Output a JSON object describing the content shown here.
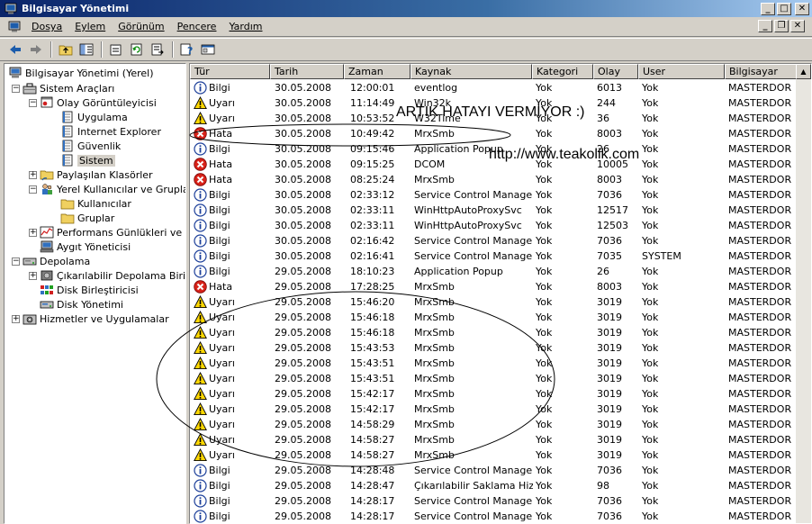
{
  "window": {
    "title": "Bilgisayar Yönetimi"
  },
  "menubar": {
    "items": [
      {
        "label": "Dosya"
      },
      {
        "label": "Eylem"
      },
      {
        "label": "Görünüm"
      },
      {
        "label": "Pencere"
      },
      {
        "label": "Yardım"
      }
    ]
  },
  "toolbar": {
    "buttons": [
      "back-icon",
      "forward-icon",
      "up-folder-icon",
      "show-tree-icon",
      "properties-icon",
      "refresh-icon",
      "export-icon",
      "help-icon",
      "console-icon"
    ]
  },
  "tree": {
    "items": [
      {
        "label": "Bilgisayar Yönetimi (Yerel)"
      },
      {
        "label": "Sistem Araçları"
      },
      {
        "label": "Olay Görüntüleyicisi"
      },
      {
        "label": "Uygulama"
      },
      {
        "label": "Internet Explorer"
      },
      {
        "label": "Güvenlik"
      },
      {
        "label": "Sistem"
      },
      {
        "label": "Paylaşılan Klasörler"
      },
      {
        "label": "Yerel Kullanıcılar ve Gruplar"
      },
      {
        "label": "Kullanıcılar"
      },
      {
        "label": "Gruplar"
      },
      {
        "label": "Performans Günlükleri ve Uy"
      },
      {
        "label": "Aygıt Yöneticisi"
      },
      {
        "label": "Depolama"
      },
      {
        "label": "Çıkarılabilir Depolama Birimi"
      },
      {
        "label": "Disk Birleştiricisi"
      },
      {
        "label": "Disk Yönetimi"
      },
      {
        "label": "Hizmetler ve Uygulamalar"
      }
    ]
  },
  "list": {
    "columns": [
      "Tür",
      "Tarih",
      "Zaman",
      "Kaynak",
      "Kategori",
      "Olay",
      "User",
      "Bilgisayar"
    ],
    "rows": [
      {
        "type": "Bilgi",
        "date": "30.05.2008",
        "time": "12:00:01",
        "source": "eventlog",
        "category": "Yok",
        "event": "6013",
        "user": "Yok",
        "computer": "MASTERDOR"
      },
      {
        "type": "Uyarı",
        "date": "30.05.2008",
        "time": "11:14:49",
        "source": "Win32k",
        "category": "Yok",
        "event": "244",
        "user": "Yok",
        "computer": "MASTERDOR"
      },
      {
        "type": "Uyarı",
        "date": "30.05.2008",
        "time": "10:53:52",
        "source": "W32Time",
        "category": "Yok",
        "event": "36",
        "user": "Yok",
        "computer": "MASTERDOR"
      },
      {
        "type": "Hata",
        "date": "30.05.2008",
        "time": "10:49:42",
        "source": "MrxSmb",
        "category": "Yok",
        "event": "8003",
        "user": "Yok",
        "computer": "MASTERDOR"
      },
      {
        "type": "Bilgi",
        "date": "30.05.2008",
        "time": "09:15:46",
        "source": "Application Popup",
        "category": "Yok",
        "event": "26",
        "user": "Yok",
        "computer": "MASTERDOR"
      },
      {
        "type": "Hata",
        "date": "30.05.2008",
        "time": "09:15:25",
        "source": "DCOM",
        "category": "Yok",
        "event": "10005",
        "user": "Yok",
        "computer": "MASTERDOR"
      },
      {
        "type": "Hata",
        "date": "30.05.2008",
        "time": "08:25:24",
        "source": "MrxSmb",
        "category": "Yok",
        "event": "8003",
        "user": "Yok",
        "computer": "MASTERDOR"
      },
      {
        "type": "Bilgi",
        "date": "30.05.2008",
        "time": "02:33:12",
        "source": "Service Control Manager",
        "category": "Yok",
        "event": "7036",
        "user": "Yok",
        "computer": "MASTERDOR"
      },
      {
        "type": "Bilgi",
        "date": "30.05.2008",
        "time": "02:33:11",
        "source": "WinHttpAutoProxySvc",
        "category": "Yok",
        "event": "12517",
        "user": "Yok",
        "computer": "MASTERDOR"
      },
      {
        "type": "Bilgi",
        "date": "30.05.2008",
        "time": "02:33:11",
        "source": "WinHttpAutoProxySvc",
        "category": "Yok",
        "event": "12503",
        "user": "Yok",
        "computer": "MASTERDOR"
      },
      {
        "type": "Bilgi",
        "date": "30.05.2008",
        "time": "02:16:42",
        "source": "Service Control Manager",
        "category": "Yok",
        "event": "7036",
        "user": "Yok",
        "computer": "MASTERDOR"
      },
      {
        "type": "Bilgi",
        "date": "30.05.2008",
        "time": "02:16:41",
        "source": "Service Control Manager",
        "category": "Yok",
        "event": "7035",
        "user": "SYSTEM",
        "computer": "MASTERDOR"
      },
      {
        "type": "Bilgi",
        "date": "29.05.2008",
        "time": "18:10:23",
        "source": "Application Popup",
        "category": "Yok",
        "event": "26",
        "user": "Yok",
        "computer": "MASTERDOR"
      },
      {
        "type": "Hata",
        "date": "29.05.2008",
        "time": "17:28:25",
        "source": "MrxSmb",
        "category": "Yok",
        "event": "8003",
        "user": "Yok",
        "computer": "MASTERDOR"
      },
      {
        "type": "Uyarı",
        "date": "29.05.2008",
        "time": "15:46:20",
        "source": "MrxSmb",
        "category": "Yok",
        "event": "3019",
        "user": "Yok",
        "computer": "MASTERDOR"
      },
      {
        "type": "Uyarı",
        "date": "29.05.2008",
        "time": "15:46:18",
        "source": "MrxSmb",
        "category": "Yok",
        "event": "3019",
        "user": "Yok",
        "computer": "MASTERDOR"
      },
      {
        "type": "Uyarı",
        "date": "29.05.2008",
        "time": "15:46:18",
        "source": "MrxSmb",
        "category": "Yok",
        "event": "3019",
        "user": "Yok",
        "computer": "MASTERDOR"
      },
      {
        "type": "Uyarı",
        "date": "29.05.2008",
        "time": "15:43:53",
        "source": "MrxSmb",
        "category": "Yok",
        "event": "3019",
        "user": "Yok",
        "computer": "MASTERDOR"
      },
      {
        "type": "Uyarı",
        "date": "29.05.2008",
        "time": "15:43:51",
        "source": "MrxSmb",
        "category": "Yok",
        "event": "3019",
        "user": "Yok",
        "computer": "MASTERDOR"
      },
      {
        "type": "Uyarı",
        "date": "29.05.2008",
        "time": "15:43:51",
        "source": "MrxSmb",
        "category": "Yok",
        "event": "3019",
        "user": "Yok",
        "computer": "MASTERDOR"
      },
      {
        "type": "Uyarı",
        "date": "29.05.2008",
        "time": "15:42:17",
        "source": "MrxSmb",
        "category": "Yok",
        "event": "3019",
        "user": "Yok",
        "computer": "MASTERDOR"
      },
      {
        "type": "Uyarı",
        "date": "29.05.2008",
        "time": "15:42:17",
        "source": "MrxSmb",
        "category": "Yok",
        "event": "3019",
        "user": "Yok",
        "computer": "MASTERDOR"
      },
      {
        "type": "Uyarı",
        "date": "29.05.2008",
        "time": "14:58:29",
        "source": "MrxSmb",
        "category": "Yok",
        "event": "3019",
        "user": "Yok",
        "computer": "MASTERDOR"
      },
      {
        "type": "Uyarı",
        "date": "29.05.2008",
        "time": "14:58:27",
        "source": "MrxSmb",
        "category": "Yok",
        "event": "3019",
        "user": "Yok",
        "computer": "MASTERDOR"
      },
      {
        "type": "Uyarı",
        "date": "29.05.2008",
        "time": "14:58:27",
        "source": "MrxSmb",
        "category": "Yok",
        "event": "3019",
        "user": "Yok",
        "computer": "MASTERDOR"
      },
      {
        "type": "Bilgi",
        "date": "29.05.2008",
        "time": "14:28:48",
        "source": "Service Control Manager",
        "category": "Yok",
        "event": "7036",
        "user": "Yok",
        "computer": "MASTERDOR"
      },
      {
        "type": "Bilgi",
        "date": "29.05.2008",
        "time": "14:28:47",
        "source": "Çıkarılabilir Saklama Hiz...",
        "category": "Yok",
        "event": "98",
        "user": "Yok",
        "computer": "MASTERDOR"
      },
      {
        "type": "Bilgi",
        "date": "29.05.2008",
        "time": "14:28:17",
        "source": "Service Control Manager",
        "category": "Yok",
        "event": "7036",
        "user": "Yok",
        "computer": "MASTERDOR"
      },
      {
        "type": "Bilgi",
        "date": "29.05.2008",
        "time": "14:28:17",
        "source": "Service Control Manager",
        "category": "Yok",
        "event": "7036",
        "user": "Yok",
        "computer": "MASTERDOR"
      }
    ]
  },
  "annotations": {
    "headline": "ARTIK HATAYI VERMİYOR :)",
    "url": "http://www.teakolik.com"
  }
}
